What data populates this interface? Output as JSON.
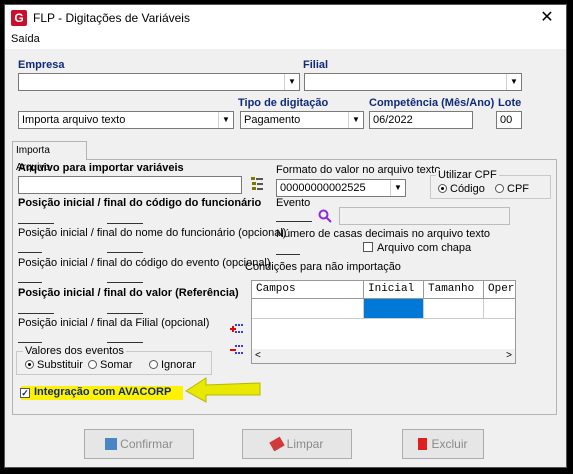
{
  "window": {
    "title": "FLP - Digitações de Variáveis",
    "icon": "app-logo-icon"
  },
  "menu": {
    "saida": "Saída"
  },
  "empresa": {
    "label": "Empresa",
    "value": ""
  },
  "filial": {
    "label": "Filial",
    "value": ""
  },
  "operacao": {
    "value": "Importa arquivo texto"
  },
  "tipo": {
    "label": "Tipo de digitação",
    "value": "Pagamento"
  },
  "competencia": {
    "label": "Competência (Mês/Ano)",
    "value": "06/2022"
  },
  "lote": {
    "label": "Lote",
    "value": "00"
  },
  "tab": {
    "label": "Importa Arquivo"
  },
  "arquivo": {
    "label": "Arquivo para importar variáveis",
    "value": ""
  },
  "formato": {
    "label": "Formato do valor no arquivo texto",
    "value": "00000000002525"
  },
  "utilizar_cpf": {
    "title": "Utilizar CPF",
    "opt1": "Código",
    "opt2": "CPF",
    "selected": "Código"
  },
  "evento": {
    "label": "Evento",
    "code": "",
    "desc": ""
  },
  "casas": {
    "label": "Número de casas decimais no arquivo texto",
    "value": ""
  },
  "arquivo_chapa": {
    "label": "Arquivo com chapa",
    "checked": false
  },
  "pos_codigo": {
    "label": "Posição inicial / final do código do funcionário"
  },
  "pos_nome": {
    "label": "Posição inicial / final do nome do funcionário (opcional)"
  },
  "pos_evento": {
    "label": "Posição inicial / final do código do evento (opcional)"
  },
  "pos_valor": {
    "label": "Posição inicial / final do valor (Referência)"
  },
  "pos_filial": {
    "label": "Posição inicial / final da Filial  (opcional)"
  },
  "condicoes": {
    "label": "Condições para não importação",
    "columns": [
      "Campos",
      "Inicial",
      "Tamanho",
      "Opera"
    ]
  },
  "valores": {
    "title": "Valores dos eventos",
    "opt1": "Substituir",
    "opt2": "Somar",
    "opt3": "Ignorar",
    "selected": "Substituir"
  },
  "integracao": {
    "label": "Integração com AVACORP",
    "checked": true
  },
  "buttons": {
    "confirmar": "Confirmar",
    "limpar": "Limpar",
    "excluir": "Excluir"
  },
  "colors": {
    "label_blue": "#102a7a",
    "highlight": "#fff200",
    "arrow": "#e8e800",
    "selected_cell": "#0078d7"
  }
}
